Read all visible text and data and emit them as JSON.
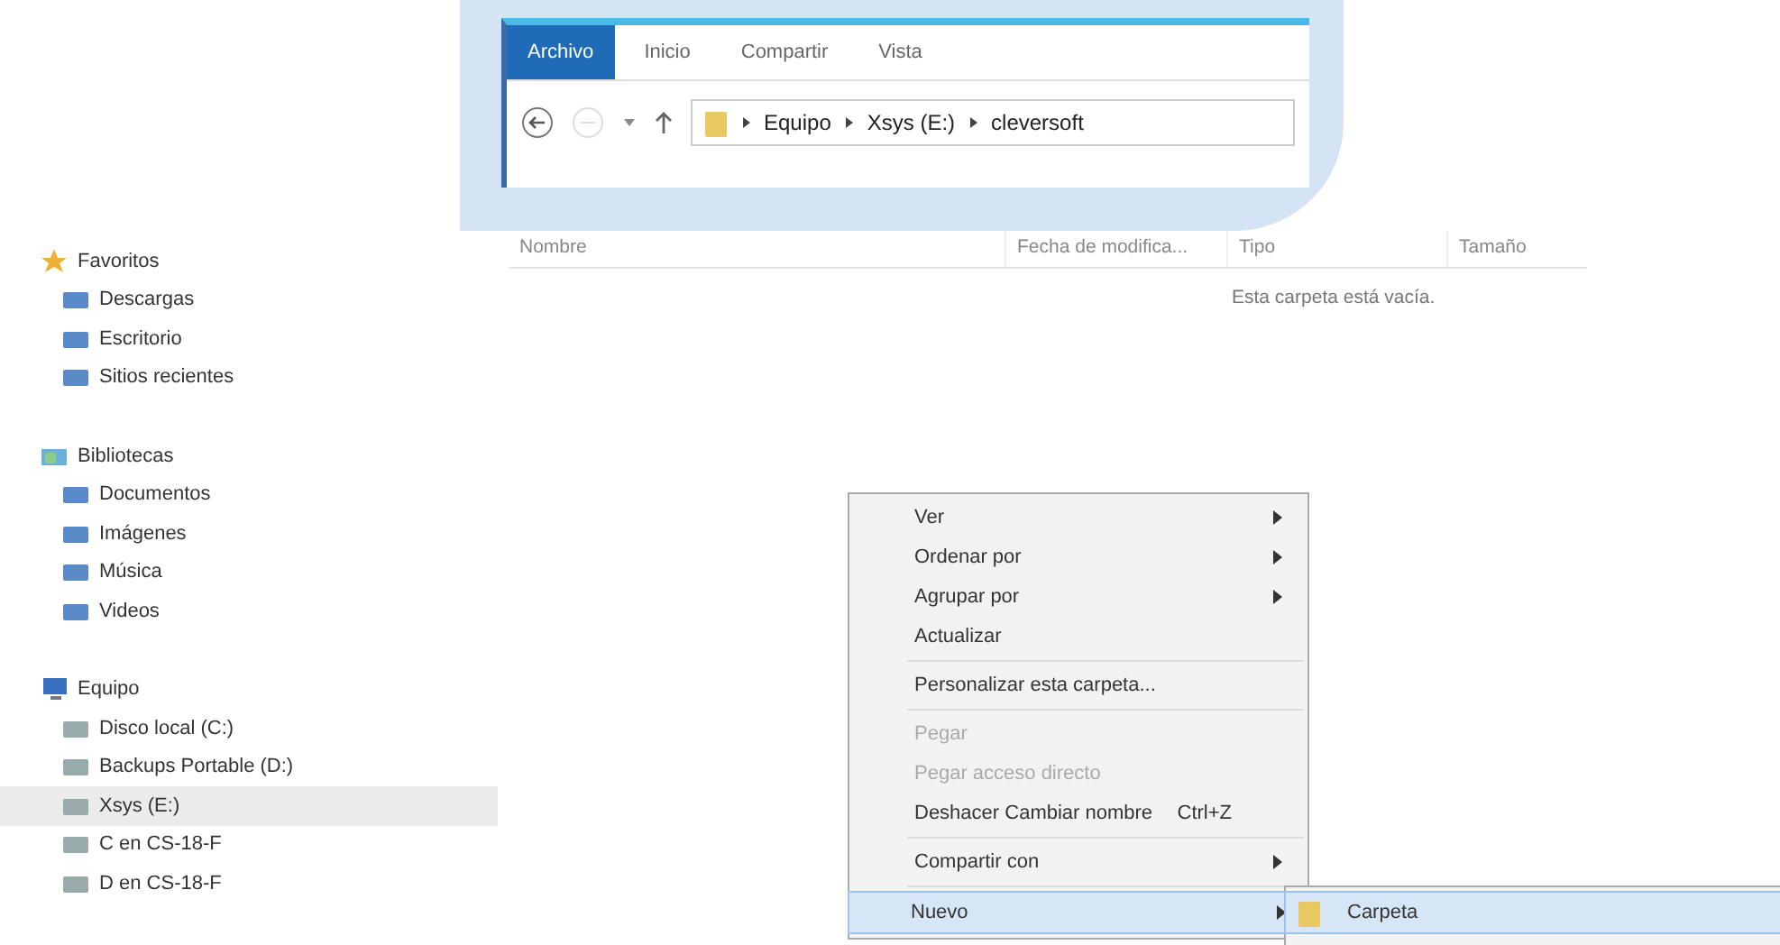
{
  "ribbon": {
    "tabs": [
      {
        "label": "Archivo",
        "selected": true
      },
      {
        "label": "Inicio",
        "selected": false
      },
      {
        "label": "Compartir",
        "selected": false
      },
      {
        "label": "Vista",
        "selected": false
      }
    ],
    "address": {
      "segments": [
        "Equipo",
        "Xsys (E:)",
        "cleversoft"
      ]
    }
  },
  "sidebar": {
    "groups": [
      {
        "label": "Favoritos",
        "items": [
          {
            "label": "Descargas",
            "selected": false
          },
          {
            "label": "Escritorio",
            "selected": false
          },
          {
            "label": "Sitios recientes",
            "selected": false
          }
        ]
      },
      {
        "label": "Bibliotecas",
        "items": [
          {
            "label": "Documentos",
            "selected": false
          },
          {
            "label": "Imágenes",
            "selected": false
          },
          {
            "label": "Música",
            "selected": false
          },
          {
            "label": "Videos",
            "selected": false
          }
        ]
      },
      {
        "label": "Equipo",
        "items": [
          {
            "label": "Disco local (C:)",
            "selected": false
          },
          {
            "label": "Backups Portable (D:)",
            "selected": false
          },
          {
            "label": "Xsys (E:)",
            "selected": true
          },
          {
            "label": "C en CS-18-F",
            "selected": false
          },
          {
            "label": "D en CS-18-F",
            "selected": false
          }
        ]
      }
    ]
  },
  "table": {
    "columns": [
      "Nombre",
      "Fecha de modifica...",
      "Tipo",
      "Tamaño"
    ],
    "empty_message": "Esta carpeta está vacía."
  },
  "context_menu": {
    "items": [
      {
        "kind": "item",
        "label": "Ver",
        "submenu": true,
        "disabled": false,
        "selected": false
      },
      {
        "kind": "item",
        "label": "Ordenar por",
        "submenu": true,
        "disabled": false,
        "selected": false
      },
      {
        "kind": "item",
        "label": "Agrupar por",
        "submenu": true,
        "disabled": false,
        "selected": false
      },
      {
        "kind": "item",
        "label": "Actualizar",
        "submenu": false,
        "disabled": false,
        "selected": false
      },
      {
        "kind": "separator"
      },
      {
        "kind": "item",
        "label": "Personalizar esta carpeta...",
        "submenu": false,
        "disabled": false,
        "selected": false
      },
      {
        "kind": "separator"
      },
      {
        "kind": "item",
        "label": "Pegar",
        "submenu": false,
        "disabled": true,
        "selected": false
      },
      {
        "kind": "item",
        "label": "Pegar acceso directo",
        "submenu": false,
        "disabled": true,
        "selected": false
      },
      {
        "kind": "item",
        "label": "Deshacer Cambiar nombre",
        "shortcut": "Ctrl+Z",
        "submenu": false,
        "disabled": false,
        "selected": false
      },
      {
        "kind": "separator"
      },
      {
        "kind": "item",
        "label": "Compartir con",
        "submenu": true,
        "disabled": false,
        "selected": false
      },
      {
        "kind": "separator"
      },
      {
        "kind": "item",
        "label": "Nuevo",
        "submenu": true,
        "disabled": false,
        "selected": true
      }
    ]
  },
  "submenu": {
    "items": [
      {
        "label": "Carpeta",
        "selected": true
      }
    ]
  }
}
